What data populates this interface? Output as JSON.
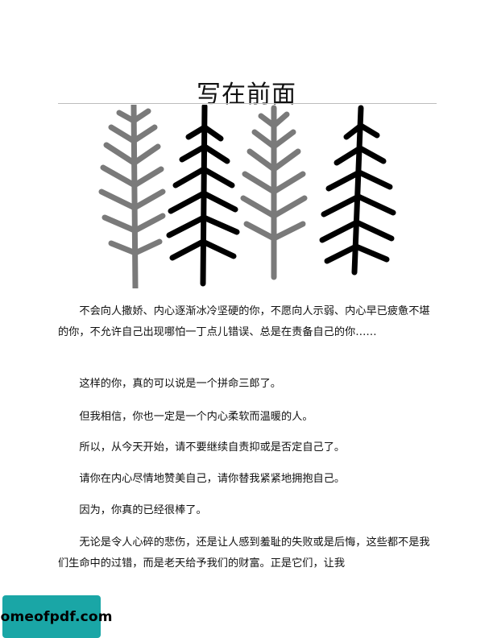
{
  "page": {
    "title": "写在前面",
    "paragraphs": [
      "不会向人撒娇、内心逐渐冰冷坚硬的你，不愿向人示弱、内心早已疲惫不堪的你，不允许自己出现哪怕一丁点儿错误、总是在责备自己的你……",
      "这样的你，真的可以说是一个拼命三郎了。",
      "但我相信，你也一定是一个内心柔软而温暖的人。",
      "所以，从今天开始，请不要继续自责抑或是否定自己了。",
      "请你在内心尽情地赞美自己，请你替我紧紧地拥抱自己。",
      "因为，你真的已经很棒了。",
      "无论是令人心碎的悲伤，还是让人感到羞耻的失败或是后悔，这些都不是我们生命中的过错，而是老天给予我们的财富。正是它们，让我"
    ]
  },
  "illustration": {
    "description_icon": "four-pine-trees-illustration",
    "colors": [
      "#7a7a7a",
      "#000000",
      "#7a7a7a",
      "#000000"
    ]
  },
  "watermark": {
    "text": "homeofpdf.com",
    "color": "#1aa6a6"
  }
}
